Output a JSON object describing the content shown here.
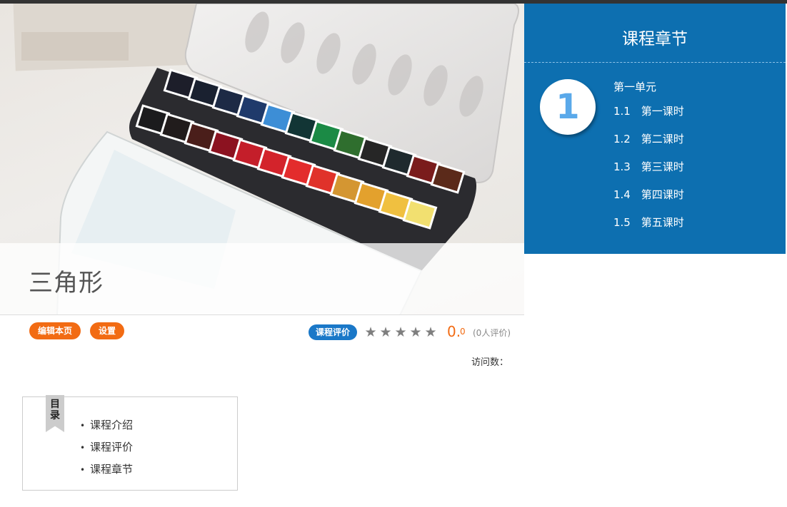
{
  "hero": {
    "title": "三角形"
  },
  "chapters": {
    "heading": "课程章节",
    "unit_number": "1",
    "unit_name": "第一单元",
    "lessons": [
      {
        "num": "1.1",
        "label": "第一课时"
      },
      {
        "num": "1.2",
        "label": "第二课时"
      },
      {
        "num": "1.3",
        "label": "第三课时"
      },
      {
        "num": "1.4",
        "label": "第四课时"
      },
      {
        "num": "1.5",
        "label": "第五课时"
      }
    ]
  },
  "actions": {
    "edit_label": "编辑本页",
    "settings_label": "设置"
  },
  "rating": {
    "badge_label": "课程评价",
    "stars": 5,
    "score_int": "0.",
    "score_dec": "0",
    "count_label": "(0人评价)"
  },
  "visits": {
    "label": "访问数："
  },
  "toc": {
    "ribbon_label": "目录",
    "items": [
      "课程介绍",
      "课程评价",
      "课程章节"
    ]
  },
  "colors": {
    "chapter_bg": "#0d6fb0",
    "accent_orange": "#f26b13",
    "badge_blue": "#1a78c8"
  }
}
